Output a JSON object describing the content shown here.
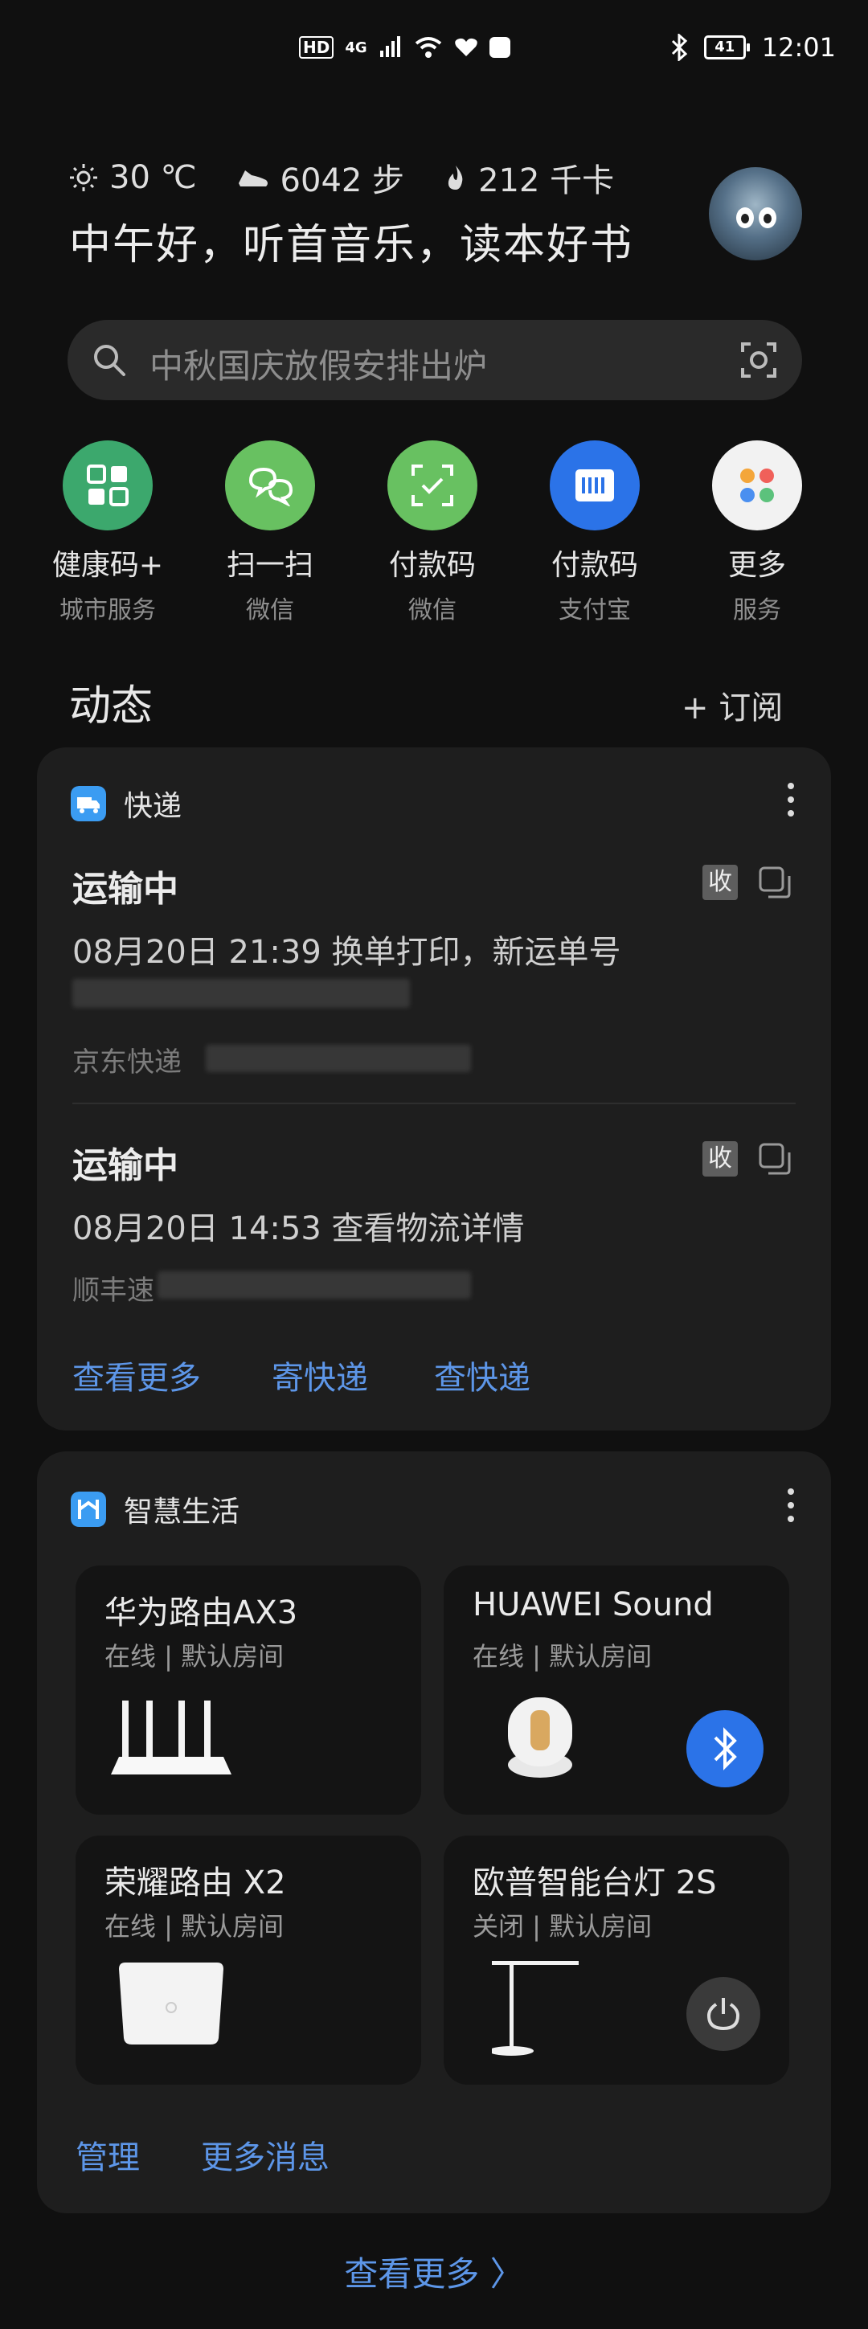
{
  "status": {
    "left_icons": [
      "HD",
      "4G"
    ],
    "time": "12:01",
    "battery": "41"
  },
  "header": {
    "weather": "30 ℃",
    "steps": "6042 步",
    "calories": "212 千卡",
    "greeting": "中午好，听首音乐，读本好书",
    "icons": [
      "sun-icon",
      "shoe-icon",
      "flame-icon",
      "avatar"
    ]
  },
  "search": {
    "query": "中秋国庆放假安排出炉"
  },
  "quick_actions": [
    {
      "title": "健康码+",
      "subtitle": "城市服务",
      "color": "#3ca86d",
      "icon": "health-code-icon"
    },
    {
      "title": "扫一扫",
      "subtitle": "微信",
      "color": "#68c161",
      "icon": "scan-icon"
    },
    {
      "title": "付款码",
      "subtitle": "微信",
      "color": "#68c161",
      "icon": "pay-code-icon"
    },
    {
      "title": "付款码",
      "subtitle": "支付宝",
      "color": "#2b73e8",
      "icon": "barcode-icon"
    },
    {
      "title": "更多",
      "subtitle": "服务",
      "color": "#f2f2f2",
      "icon": "more-apps-icon"
    }
  ],
  "feed": {
    "title": "动态",
    "subscribe": "+ 订阅"
  },
  "express": {
    "title": "快递",
    "items": [
      {
        "status": "运输中",
        "desc": "08月20日 21:39  换单打印，新运单号",
        "carrier": "京东快递",
        "tag": "收"
      },
      {
        "status": "运输中",
        "desc": "08月20日 14:53  查看物流详情",
        "carrier": "顺丰速",
        "tag": "收"
      }
    ],
    "links": [
      "查看更多",
      "寄快递",
      "查快递"
    ]
  },
  "smart_life": {
    "title": "智慧生活",
    "devices": [
      {
        "name": "华为路由AX3",
        "status": "在线 | 默认房间"
      },
      {
        "name": "HUAWEI Sound",
        "status": "在线 | 默认房间"
      },
      {
        "name": "荣耀路由 X2",
        "status": "在线 | 默认房间"
      },
      {
        "name": "欧普智能台灯 2S",
        "status": "关闭 | 默认房间"
      }
    ],
    "links": [
      "管理",
      "更多消息"
    ]
  },
  "bottom_more": "查看更多 〉",
  "colors": {
    "accent_link": "#5d96e8",
    "bluetooth": "#2b73e8"
  }
}
